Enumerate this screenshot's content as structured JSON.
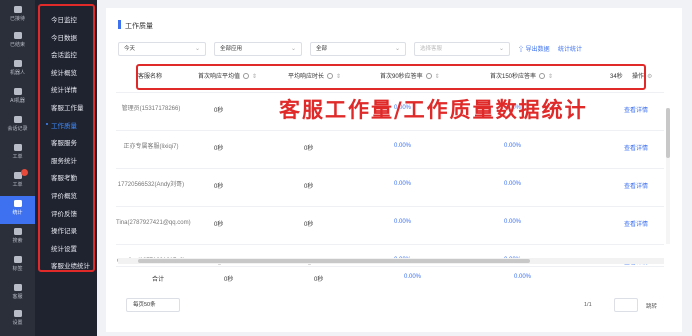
{
  "rail": [
    {
      "label": "已接待",
      "icon": "chat-icon"
    },
    {
      "label": "已结束",
      "icon": "history-icon"
    },
    {
      "label": "机器人",
      "icon": "robot-icon"
    },
    {
      "label": "AI机器",
      "icon": "ai-bot-icon"
    },
    {
      "label": "会话记录",
      "icon": "record-icon"
    },
    {
      "label": "工单",
      "icon": "ticket-icon"
    },
    {
      "label": "工单",
      "icon": "list-icon"
    },
    {
      "label": "统计",
      "icon": "stats-icon"
    },
    {
      "label": "搜索",
      "icon": "search-icon"
    },
    {
      "label": "标签",
      "icon": "tag-icon"
    },
    {
      "label": "客服",
      "icon": "agent-icon"
    },
    {
      "label": "设置",
      "icon": "gear-icon"
    }
  ],
  "menu": [
    "今日监控",
    "今日数据",
    "会话监控",
    "统计概览",
    "统计详情",
    "客服工作量",
    "工作质量",
    "客服服务",
    "服务统计",
    "客服考勤",
    "评价概览",
    "评价反馈",
    "操作记录",
    "统计设置",
    "客服业绩统计"
  ],
  "page_title": "工作质量",
  "filters": {
    "time": "今天",
    "app": "全部应用",
    "group": "全部",
    "agent_placeholder": "选择客服"
  },
  "links": {
    "export": "导出数据",
    "stat_config": "统计统计"
  },
  "columns": {
    "name": "客服名称",
    "avg_first": "首次响应平均值",
    "avg_resp": "平均响应时长",
    "rate90": "首次90秒应答率",
    "rate150": "首次150秒应答率",
    "more": "34秒",
    "op": "操作"
  },
  "rows": [
    {
      "name": "管理员(15317178266)",
      "avg_first": "0秒",
      "avg_resp": "0秒",
      "rate90": "0.00%",
      "rate150": "0.00%",
      "action": "查看详情"
    },
    {
      "name": "正亦专属客服(lixiqi7)",
      "avg_first": "0秒",
      "avg_resp": "0秒",
      "rate90": "0.00%",
      "rate150": "0.00%",
      "action": "查看详情"
    },
    {
      "name": "17720566532(Andy刘哥)",
      "avg_first": "0秒",
      "avg_resp": "0秒",
      "rate90": "0.00%",
      "rate150": "0.00%",
      "action": "查看详情"
    },
    {
      "name": "Tina(2787927421@qq.com)",
      "avg_first": "0秒",
      "avg_resp": "0秒",
      "rate90": "0.00%",
      "rate150": "0.00%",
      "action": "查看详情"
    },
    {
      "name": "candice(18771001217_2)",
      "avg_first": "0秒",
      "avg_resp": "0秒",
      "rate90": "0.00%",
      "rate150": "0.00%",
      "action": "查看详情"
    }
  ],
  "total": {
    "label": "合计",
    "avg_first": "0秒",
    "avg_resp": "0秒",
    "rate90": "0.00%",
    "rate150": "0.00%"
  },
  "overlay_text": "客服工作量/工作质量数据统计",
  "pager": {
    "size": "每页50条",
    "info": "1/1",
    "go": "跳转"
  }
}
